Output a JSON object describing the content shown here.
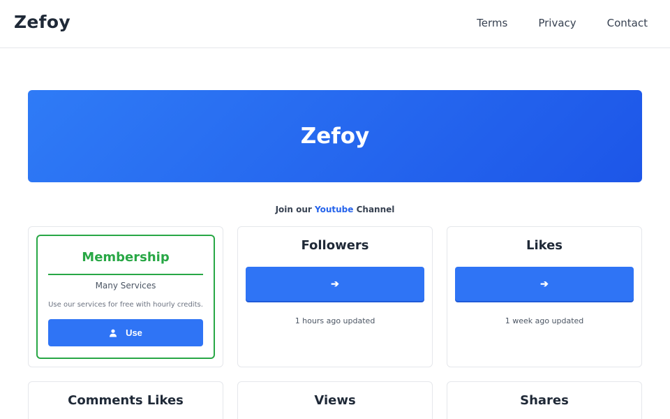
{
  "nav": {
    "brand": "Zefoy",
    "links": [
      "Terms",
      "Privacy",
      "Contact"
    ]
  },
  "hero": {
    "title": "Zefoy"
  },
  "join": {
    "prefix": "Join our ",
    "link": "Youtube",
    "suffix": " Channel"
  },
  "membership": {
    "title": "Membership",
    "subtitle": "Many Services",
    "description": "Use our services for free with hourly credits.",
    "button_label": "Use",
    "button_icon": "user-icon"
  },
  "cards": [
    {
      "title": "Followers",
      "button_icon": "arrow-right-icon",
      "arrow": "➔",
      "updated": "1 hours ago updated"
    },
    {
      "title": "Likes",
      "button_icon": "arrow-right-icon",
      "arrow": "➔",
      "updated": "1 week ago updated"
    },
    {
      "title": "Comments Likes"
    },
    {
      "title": "Views"
    },
    {
      "title": "Shares"
    }
  ],
  "colors": {
    "primary": "#2f74f5",
    "hero_start": "#2f7bf6",
    "hero_end": "#1d56e8",
    "membership_green": "#28a745",
    "link": "#2563eb"
  }
}
